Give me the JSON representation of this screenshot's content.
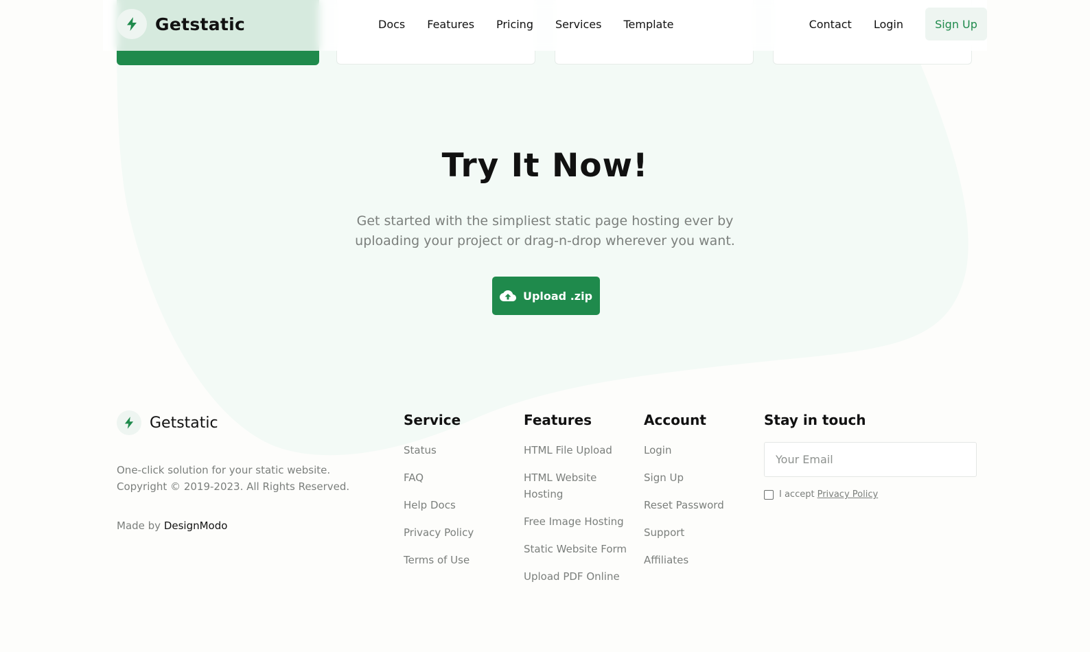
{
  "brand": {
    "name": "Getstatic",
    "accent": "#1f8a4c",
    "accent_soft": "#eef5f1",
    "blob": "#f3faf6"
  },
  "header": {
    "nav": [
      "Docs",
      "Features",
      "Pricing",
      "Services",
      "Template"
    ],
    "contact": "Contact",
    "login": "Login",
    "signup": "Sign Up"
  },
  "hero": {
    "title": "Try It Now!",
    "subtitle": "Get started with the simpliest static page hosting ever by uploading your project or drag-n-drop wherever you want.",
    "upload_label": "Upload .zip",
    "upload_icon": "cloud-upload-icon"
  },
  "footer": {
    "brand": "Getstatic",
    "desc_line1": "One-click solution for your static website.",
    "desc_line2": "Copyright © 2019-2023. All Rights Reserved.",
    "made_by_prefix": "Made by ",
    "made_by_link": "DesignModo",
    "service": {
      "title": "Service",
      "items": [
        "Status",
        "FAQ",
        "Help Docs",
        "Privacy Policy",
        "Terms of Use"
      ]
    },
    "features": {
      "title": "Features",
      "items": [
        "HTML File Upload",
        "HTML Website Hosting",
        "Free Image Hosting",
        "Static Website Form",
        "Upload PDF Online"
      ]
    },
    "account": {
      "title": "Account",
      "items": [
        "Login",
        "Sign Up",
        "Reset Password",
        "Support",
        "Affiliates"
      ]
    },
    "touch": {
      "title": "Stay in touch",
      "email_placeholder": "Your Email",
      "accept_prefix": "I accept",
      "privacy_link": "Privacy Policy"
    }
  },
  "icons": {
    "logo": "lightning-bolt-icon",
    "upload": "cloud-upload-icon"
  }
}
